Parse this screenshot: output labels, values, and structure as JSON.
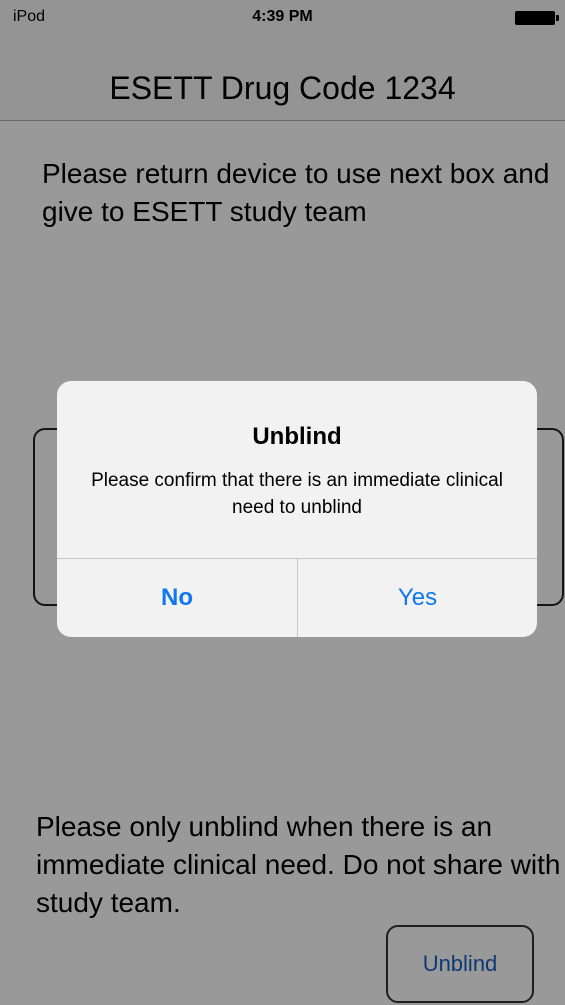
{
  "status_bar": {
    "carrier": "iPod",
    "time": "4:39 PM",
    "battery_icon": "battery-full-icon"
  },
  "nav": {
    "title": "ESETT Drug Code 1234"
  },
  "content": {
    "instruction": "Please return device to use next box and give to ESETT study team",
    "warning": "Please only unblind when there is an immediate clinical need.  Do not share with study team.",
    "unblind_label": "Unblind"
  },
  "alert": {
    "title": "Unblind",
    "message": "Please confirm that there is an immediate clinical need to unblind",
    "no_label": "No",
    "yes_label": "Yes"
  },
  "colors": {
    "accent": "#1277ee",
    "dim_overlay": "rgba(0,0,0,0.40)"
  }
}
